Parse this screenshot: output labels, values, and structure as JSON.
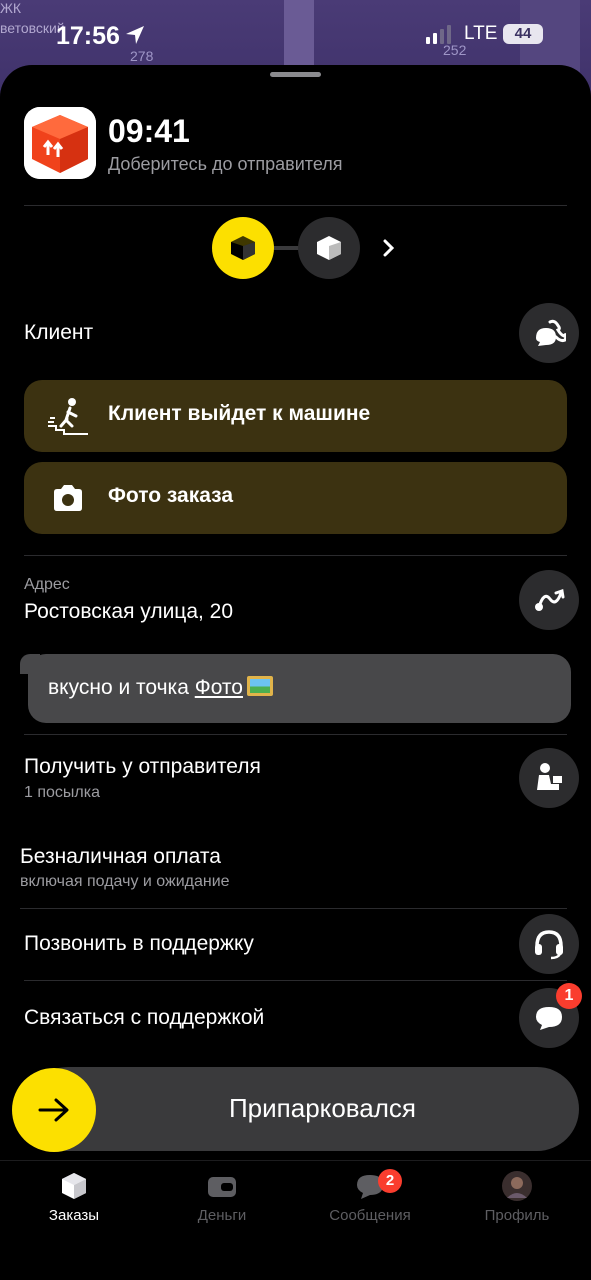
{
  "map": {
    "street": "ЖК\nветовский",
    "house_left": "278",
    "house_right": "252"
  },
  "status_bar": {
    "time": "17:56",
    "network": "LTE",
    "battery": "44"
  },
  "order": {
    "eta_time": "09:41",
    "eta_subtitle": "Доберитесь до отправителя"
  },
  "client": {
    "title": "Клиент",
    "options": [
      {
        "label": "Клиент выйдет к машине",
        "icon": "walking-person-icon"
      },
      {
        "label": "Фото заказа",
        "icon": "camera-icon"
      }
    ]
  },
  "address": {
    "label": "Адрес",
    "value": "Ростовская улица, 20"
  },
  "comment": {
    "text": "вкусно и точка ",
    "link": "Фото"
  },
  "pickup": {
    "title": "Получить у отправителя",
    "subtitle": "1 посылка"
  },
  "payment": {
    "title": "Безналичная оплата",
    "subtitle": "включая подачу и ожидание"
  },
  "support": {
    "call_label": "Позвонить в поддержку",
    "chat_label": "Связаться с поддержкой",
    "chat_badge": "1"
  },
  "action": {
    "label": "Припарковался"
  },
  "tabs": [
    {
      "label": "Заказы",
      "icon": "box-icon",
      "active": true
    },
    {
      "label": "Деньги",
      "icon": "wallet-icon"
    },
    {
      "label": "Сообщения",
      "icon": "chat-icon",
      "badge": "2"
    },
    {
      "label": "Профиль",
      "icon": "avatar-icon"
    }
  ],
  "colors": {
    "accent": "#fce000",
    "pill_bg": "#3c3211",
    "badge": "#fa3d2e",
    "map": "#4a3b76"
  }
}
